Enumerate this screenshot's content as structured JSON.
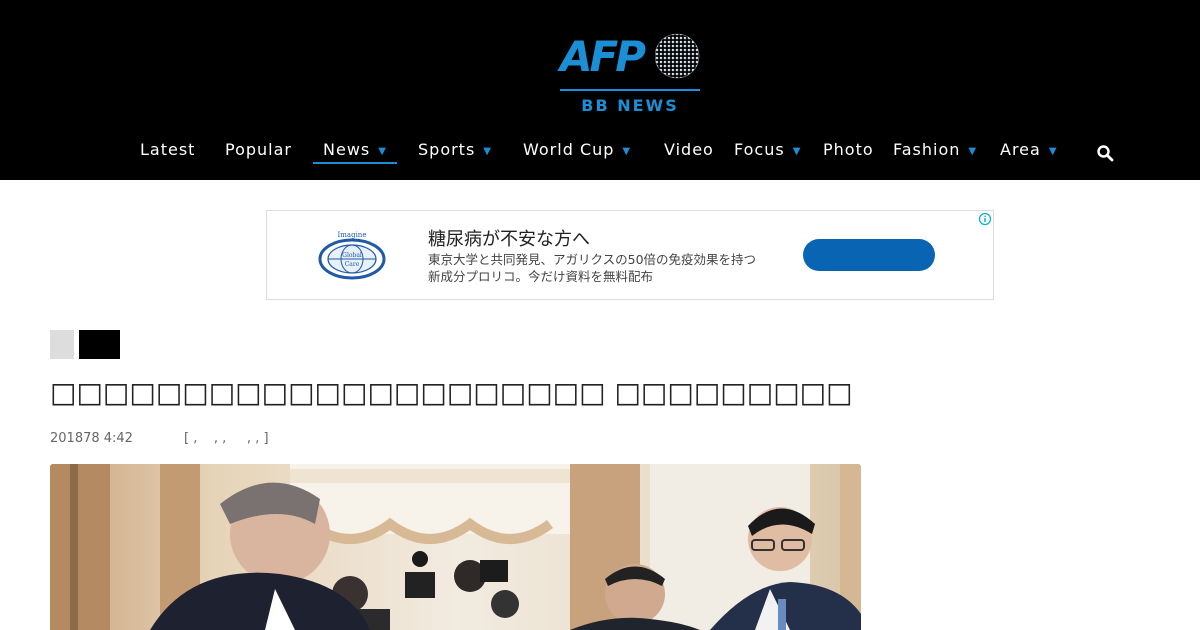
{
  "brand": {
    "logo_text": "AFP",
    "logo_sub": "BB NEWS",
    "accent": "#1a8fd6"
  },
  "nav": {
    "items": [
      {
        "label": "Latest",
        "dropdown": false
      },
      {
        "label": "Popular",
        "dropdown": false
      },
      {
        "label": "News",
        "dropdown": true,
        "active": true
      },
      {
        "label": "Sports",
        "dropdown": true
      },
      {
        "label": "World Cup",
        "dropdown": true
      },
      {
        "label": "Video",
        "dropdown": false
      },
      {
        "label": "Focus",
        "dropdown": true
      },
      {
        "label": "Photo",
        "dropdown": false
      },
      {
        "label": "Fashion",
        "dropdown": true
      },
      {
        "label": "Area",
        "dropdown": true
      }
    ],
    "search_icon": "search-icon",
    "dropdown_icon": "chevron-down-icon"
  },
  "ad": {
    "logo_lines": [
      "Imagine",
      "Global",
      "Care"
    ],
    "title": "糖尿病が不安な方へ",
    "description": "東京大学と共同発見、アガリクスの50倍の免疫効果を持つ新成分プロリコ。今だけ資料を無料配布",
    "cta_label": "",
    "info_icon": "info-icon",
    "cta_color": "#0a64b4"
  },
  "article": {
    "headline": "□□□□□□□□□□□□□□□□□□□□□ □□□□□□□□□",
    "date": "201878 4:42",
    "source": "[ ,    , ,     , , ]"
  }
}
